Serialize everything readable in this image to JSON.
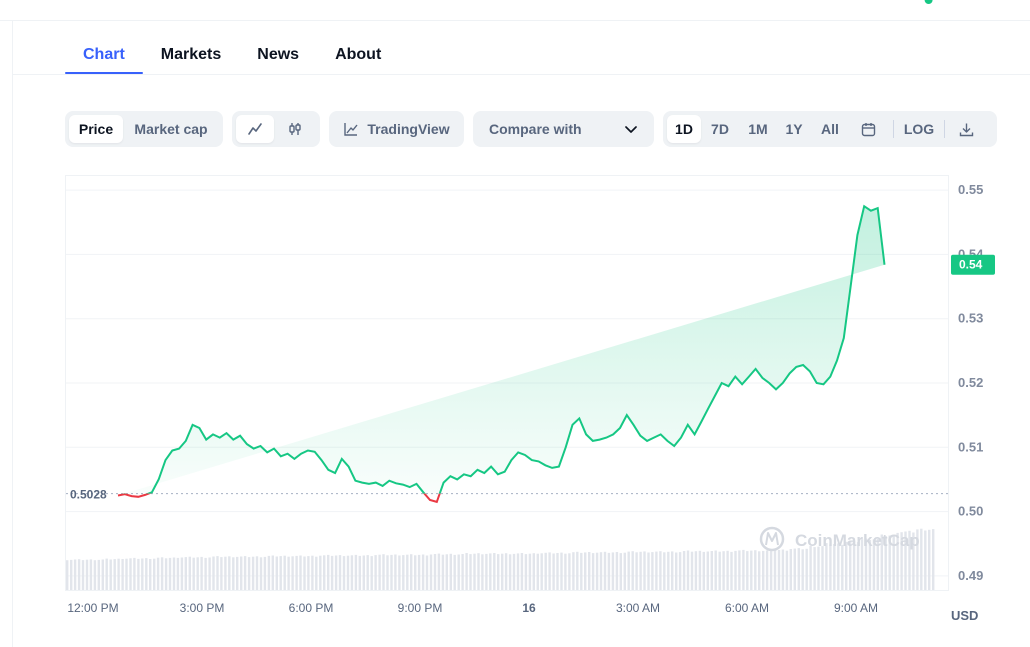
{
  "tabs": [
    {
      "label": "Chart",
      "active": true
    },
    {
      "label": "Markets",
      "active": false
    },
    {
      "label": "News",
      "active": false
    },
    {
      "label": "About",
      "active": false
    }
  ],
  "toolbar": {
    "metric": [
      {
        "label": "Price",
        "active": true
      },
      {
        "label": "Market cap",
        "active": false
      }
    ],
    "chart_style": [
      {
        "icon": "line-chart-icon",
        "active": true
      },
      {
        "icon": "candlestick-icon",
        "active": false
      }
    ],
    "tradingview_label": "TradingView",
    "compare_label": "Compare with",
    "ranges": [
      {
        "label": "1D",
        "active": true
      },
      {
        "label": "7D",
        "active": false
      },
      {
        "label": "1M",
        "active": false
      },
      {
        "label": "1Y",
        "active": false
      },
      {
        "label": "All",
        "active": false
      }
    ],
    "log_label": "LOG"
  },
  "colors": {
    "accent": "#3861fb",
    "up": "#16c784",
    "down": "#ea3943"
  },
  "chart_data": {
    "type": "line",
    "title": "",
    "xlabel": "",
    "ylabel": "",
    "currency": "USD",
    "x_ticks": [
      "12:00 PM",
      "3:00 PM",
      "6:00 PM",
      "9:00 PM",
      "16",
      "3:00 AM",
      "6:00 AM",
      "9:00 AM"
    ],
    "y_ticks": [
      "0.55",
      "0.54",
      "0.53",
      "0.52",
      "0.51",
      "0.50",
      "0.49"
    ],
    "ylim": [
      0.4878,
      0.5522
    ],
    "xlim_hours": [
      0,
      24
    ],
    "reference_price": 0.5028,
    "reference_label": "0.5028",
    "current_price": 0.5384,
    "current_label": "0.54",
    "watermark": "CoinMarketCap",
    "grid": true,
    "x_hours": [
      0,
      0.2,
      0.4,
      0.6,
      0.8,
      1.0,
      1.2,
      1.4,
      1.6,
      1.8,
      2.0,
      2.2,
      2.4,
      2.6,
      2.8,
      3.0,
      3.2,
      3.4,
      3.6,
      3.8,
      4.0,
      4.2,
      4.4,
      4.6,
      4.8,
      5.0,
      5.2,
      5.4,
      5.6,
      5.8,
      6.0,
      6.2,
      6.4,
      6.6,
      6.8,
      7.0,
      7.2,
      7.4,
      7.6,
      7.8,
      8.0,
      8.2,
      8.4,
      8.6,
      8.8,
      9.0,
      9.2,
      9.4,
      9.6,
      9.8,
      10.0,
      10.2,
      10.4,
      10.6,
      10.8,
      11.0,
      11.2,
      11.4,
      11.6,
      11.8,
      12.0,
      12.2,
      12.4,
      12.6,
      12.8,
      13.0,
      13.2,
      13.4,
      13.6,
      13.8,
      14.0,
      14.2,
      14.4,
      14.6,
      14.8,
      15.0,
      15.2,
      15.4,
      15.6,
      15.8,
      16.0,
      16.2,
      16.4,
      16.6,
      16.8,
      17.0,
      17.2,
      17.4,
      17.6,
      17.8,
      18.0,
      18.2,
      18.4,
      18.6,
      18.8,
      19.0,
      19.2,
      19.4,
      19.6,
      19.8,
      20.0,
      20.2,
      20.4,
      20.6,
      20.8,
      21.0,
      21.2,
      21.4,
      21.6,
      21.8,
      22.0,
      22.2,
      22.4,
      22.6,
      22.8,
      23.0,
      23.2,
      23.4,
      23.6,
      23.8,
      23.9
    ],
    "prices": [
      0.5025,
      0.5027,
      0.5024,
      0.5023,
      0.5026,
      0.503,
      0.505,
      0.508,
      0.5095,
      0.5098,
      0.511,
      0.5135,
      0.513,
      0.5112,
      0.512,
      0.5115,
      0.5122,
      0.5112,
      0.5118,
      0.5105,
      0.5098,
      0.5102,
      0.5092,
      0.5098,
      0.5086,
      0.509,
      0.5082,
      0.509,
      0.5095,
      0.5093,
      0.508,
      0.5065,
      0.506,
      0.5082,
      0.507,
      0.5048,
      0.5045,
      0.5043,
      0.5045,
      0.504,
      0.5048,
      0.5044,
      0.5042,
      0.5038,
      0.5043,
      0.503,
      0.5018,
      0.5015,
      0.5045,
      0.5055,
      0.505,
      0.5058,
      0.5055,
      0.5065,
      0.506,
      0.507,
      0.5058,
      0.5062,
      0.508,
      0.5092,
      0.5088,
      0.508,
      0.5078,
      0.5072,
      0.5068,
      0.507,
      0.51,
      0.5135,
      0.5145,
      0.512,
      0.511,
      0.5112,
      0.5115,
      0.512,
      0.513,
      0.515,
      0.5135,
      0.5118,
      0.511,
      0.5115,
      0.512,
      0.511,
      0.5102,
      0.5115,
      0.5135,
      0.512,
      0.514,
      0.516,
      0.518,
      0.52,
      0.5195,
      0.521,
      0.5198,
      0.521,
      0.5222,
      0.5208,
      0.52,
      0.519,
      0.52,
      0.5215,
      0.5225,
      0.5228,
      0.5218,
      0.52,
      0.5198,
      0.521,
      0.5235,
      0.527,
      0.535,
      0.543,
      0.5475,
      0.5468,
      0.5472,
      0.5384
    ],
    "volume_relative": [
      0.5,
      0.5,
      0.51,
      0.52,
      0.52,
      0.53,
      0.54,
      0.54,
      0.55,
      0.55,
      0.55,
      0.56,
      0.56,
      0.56,
      0.57,
      0.57,
      0.57,
      0.58,
      0.58,
      0.58,
      0.59,
      0.59,
      0.6,
      0.6,
      0.6,
      0.6,
      0.61,
      0.61,
      0.62,
      0.62,
      0.62,
      0.63,
      0.63,
      0.63,
      0.64,
      0.64,
      0.64,
      0.65,
      0.65,
      0.66,
      0.68,
      0.72,
      0.76,
      0.8,
      0.84,
      0.9,
      0.96,
      1.0
    ]
  }
}
